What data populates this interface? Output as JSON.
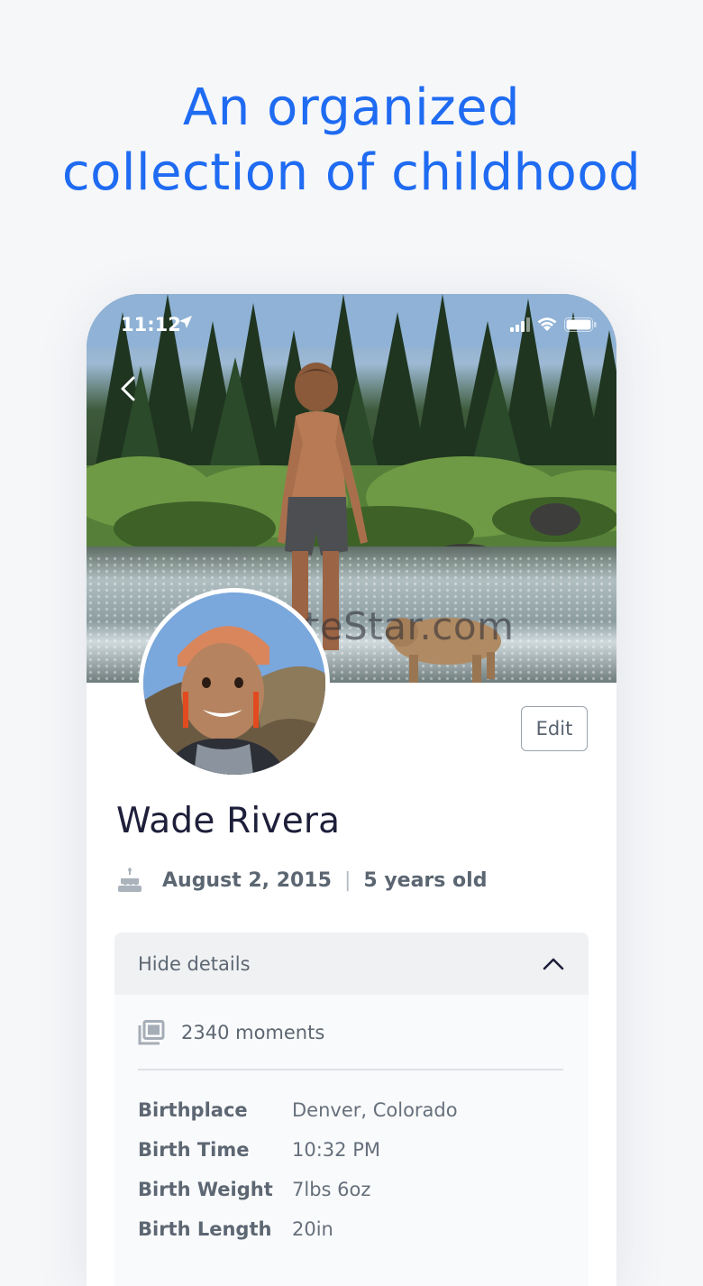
{
  "headline": {
    "line1": "An organized",
    "line2": "collection of childhood"
  },
  "status_bar": {
    "time": "11:12"
  },
  "watermark": "UpdateStar.com",
  "profile": {
    "edit_label": "Edit",
    "name": "Wade Rivera",
    "birth_date": "August 2, 2015",
    "separator": "|",
    "age": "5 years old"
  },
  "details": {
    "toggle_label": "Hide details",
    "moments": "2340 moments",
    "rows": [
      {
        "label": "Birthplace",
        "value": "Denver, Colorado"
      },
      {
        "label": "Birth Time",
        "value": "10:32 PM"
      },
      {
        "label": "Birth Weight",
        "value": "7lbs 6oz"
      },
      {
        "label": "Birth Length",
        "value": "20in"
      }
    ]
  },
  "colors": {
    "headline": "#1f6bf2",
    "name": "#1e1f3a",
    "muted": "#5d6773",
    "background": "#f6f7f9"
  },
  "icons": {
    "back": "chevron-left-icon",
    "location": "location-arrow-icon",
    "signal": "signal-icon",
    "wifi": "wifi-icon",
    "battery": "battery-icon",
    "cake": "cake-icon",
    "collapse": "chevron-up-icon",
    "moments": "photo-stack-icon"
  }
}
